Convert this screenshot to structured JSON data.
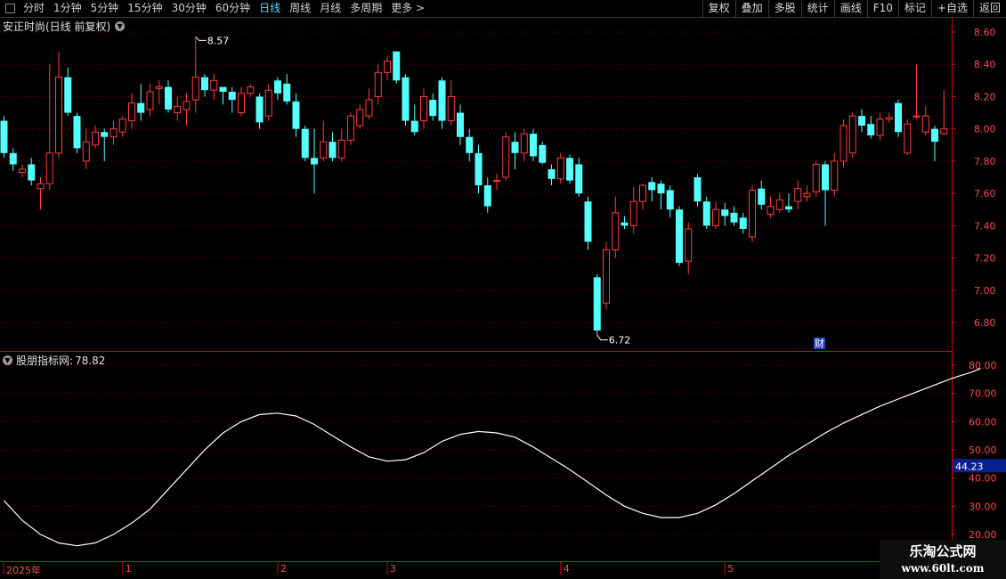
{
  "toolbar": {
    "left": [
      "分时",
      "1分钟",
      "5分钟",
      "15分钟",
      "30分钟",
      "60分钟",
      "日线",
      "周线",
      "月线",
      "多周期",
      "更多 >"
    ],
    "active": "日线",
    "right": [
      "复权",
      "叠加",
      "多股",
      "统计",
      "画线",
      "F10",
      "标记",
      "+自选",
      "返回"
    ]
  },
  "stock": {
    "title": "安正时尚(日线 前复权)"
  },
  "indicator": {
    "name": "股朋指标网",
    "sep": " : ",
    "value": "78.82",
    "cursor_value": "44.23"
  },
  "price_axis": {
    "ticks": [
      "8.60",
      "8.40",
      "8.20",
      "8.00",
      "7.80",
      "7.60",
      "7.40",
      "7.20",
      "7.00",
      "6.80"
    ],
    "min": 6.62,
    "max": 8.66
  },
  "ind_axis": {
    "ticks": [
      "80.00",
      "70.00",
      "60.00",
      "50.00",
      "40.00",
      "30.00",
      "20.00"
    ],
    "min": 15,
    "max": 85
  },
  "annotations": {
    "high": "8.57",
    "low": "6.72",
    "cai": "财"
  },
  "dates": [
    {
      "label": "2025年",
      "index": 0
    },
    {
      "label": "1",
      "index": 13
    },
    {
      "label": "2",
      "index": 30
    },
    {
      "label": "3",
      "index": 42
    },
    {
      "label": "4",
      "index": 61
    },
    {
      "label": "5",
      "index": 79
    }
  ],
  "watermark": {
    "line1": "乐淘公式网",
    "line2": "www.60lt.com"
  },
  "colors": {
    "up": "#ff3c3c",
    "down": "#54ffff",
    "grid": "#7a0000",
    "axis": "#d00000",
    "line": "#ffffff"
  },
  "chart_data": [
    {
      "type": "candlestick",
      "title": "安正时尚(日线 前复权)",
      "ylim": [
        6.62,
        8.66
      ],
      "candles": [
        [
          8.05,
          7.85,
          8.08,
          7.82
        ],
        [
          7.85,
          7.78,
          7.88,
          7.74
        ],
        [
          7.73,
          7.75,
          7.78,
          7.7
        ],
        [
          7.78,
          7.68,
          7.82,
          7.65
        ],
        [
          7.63,
          7.66,
          7.7,
          7.5
        ],
        [
          7.66,
          7.85,
          8.4,
          7.62
        ],
        [
          7.85,
          8.32,
          8.48,
          7.82
        ],
        [
          8.32,
          8.1,
          8.38,
          8.08
        ],
        [
          8.08,
          7.88,
          8.1,
          7.85
        ],
        [
          7.8,
          7.92,
          8.0,
          7.75
        ],
        [
          7.9,
          7.98,
          8.02,
          7.88
        ],
        [
          7.98,
          7.95,
          8.0,
          7.8
        ],
        [
          7.95,
          8.0,
          8.05,
          7.9
        ],
        [
          7.98,
          8.06,
          8.08,
          7.95
        ],
        [
          8.05,
          8.16,
          8.22,
          8.0
        ],
        [
          8.16,
          8.1,
          8.28,
          8.05
        ],
        [
          8.12,
          8.23,
          8.28,
          8.08
        ],
        [
          8.25,
          8.26,
          8.3,
          8.15
        ],
        [
          8.26,
          8.12,
          8.3,
          8.1
        ],
        [
          8.1,
          8.14,
          8.2,
          8.05
        ],
        [
          8.12,
          8.17,
          8.22,
          8.02
        ],
        [
          8.18,
          8.32,
          8.57,
          8.1
        ],
        [
          8.32,
          8.24,
          8.34,
          8.2
        ],
        [
          8.24,
          8.3,
          8.34,
          8.18
        ],
        [
          8.26,
          8.23,
          8.26,
          8.15
        ],
        [
          8.23,
          8.18,
          8.26,
          8.1
        ],
        [
          8.1,
          8.22,
          8.26,
          8.08
        ],
        [
          8.22,
          8.26,
          8.28,
          8.2
        ],
        [
          8.2,
          8.04,
          8.22,
          8.0
        ],
        [
          8.08,
          8.24,
          8.28,
          8.05
        ],
        [
          8.3,
          8.22,
          8.32,
          8.18
        ],
        [
          8.28,
          8.17,
          8.34,
          8.15
        ],
        [
          8.17,
          8.0,
          8.22,
          7.95
        ],
        [
          8.0,
          7.82,
          8.02,
          7.8
        ],
        [
          7.82,
          7.78,
          8.0,
          7.6
        ],
        [
          7.82,
          7.92,
          8.05,
          7.8
        ],
        [
          7.92,
          7.82,
          7.98,
          7.8
        ],
        [
          7.82,
          7.93,
          8.0,
          7.8
        ],
        [
          7.93,
          8.08,
          8.1,
          7.9
        ],
        [
          8.02,
          8.12,
          8.15,
          8.0
        ],
        [
          8.08,
          8.18,
          8.25,
          8.06
        ],
        [
          8.2,
          8.35,
          8.4,
          8.15
        ],
        [
          8.35,
          8.42,
          8.45,
          8.3
        ],
        [
          8.48,
          8.3,
          8.48,
          8.28
        ],
        [
          8.32,
          8.05,
          8.34,
          8.02
        ],
        [
          8.05,
          7.98,
          8.15,
          7.96
        ],
        [
          8.05,
          8.2,
          8.25,
          8.0
        ],
        [
          8.18,
          8.08,
          8.22,
          8.05
        ],
        [
          8.3,
          8.05,
          8.32,
          8.0
        ],
        [
          8.05,
          8.2,
          8.3,
          8.02
        ],
        [
          8.1,
          7.95,
          8.15,
          7.9
        ],
        [
          7.95,
          7.85,
          8.0,
          7.8
        ],
        [
          7.85,
          7.65,
          7.9,
          7.6
        ],
        [
          7.65,
          7.52,
          7.7,
          7.48
        ],
        [
          7.68,
          7.68,
          7.72,
          7.62
        ],
        [
          7.7,
          7.95,
          7.98,
          7.68
        ],
        [
          7.92,
          7.85,
          7.98,
          7.75
        ],
        [
          7.85,
          7.97,
          8.0,
          7.8
        ],
        [
          7.97,
          7.83,
          8.0,
          7.8
        ],
        [
          7.9,
          7.79,
          7.92,
          7.78
        ],
        [
          7.75,
          7.69,
          7.78,
          7.65
        ],
        [
          7.69,
          7.82,
          7.85,
          7.66
        ],
        [
          7.82,
          7.68,
          7.84,
          7.66
        ],
        [
          7.78,
          7.6,
          7.82,
          7.58
        ],
        [
          7.55,
          7.3,
          7.58,
          7.25
        ],
        [
          7.08,
          6.75,
          7.1,
          6.72
        ],
        [
          6.92,
          7.25,
          7.3,
          6.88
        ],
        [
          7.25,
          7.48,
          7.58,
          7.2
        ],
        [
          7.42,
          7.4,
          7.46,
          7.38
        ],
        [
          7.4,
          7.55,
          7.64,
          7.35
        ],
        [
          7.55,
          7.65,
          7.66,
          7.5
        ],
        [
          7.67,
          7.62,
          7.7,
          7.55
        ],
        [
          7.66,
          7.6,
          7.68,
          7.5
        ],
        [
          7.62,
          7.5,
          7.65,
          7.45
        ],
        [
          7.5,
          7.17,
          7.52,
          7.15
        ],
        [
          7.18,
          7.38,
          7.42,
          7.1
        ],
        [
          7.7,
          7.55,
          7.72,
          7.52
        ],
        [
          7.55,
          7.4,
          7.58,
          7.38
        ],
        [
          7.4,
          7.5,
          7.55,
          7.38
        ],
        [
          7.5,
          7.46,
          7.54,
          7.4
        ],
        [
          7.48,
          7.42,
          7.52,
          7.4
        ],
        [
          7.45,
          7.38,
          7.48,
          7.35
        ],
        [
          7.33,
          7.62,
          7.65,
          7.3
        ],
        [
          7.63,
          7.53,
          7.68,
          7.5
        ],
        [
          7.47,
          7.52,
          7.58,
          7.45
        ],
        [
          7.5,
          7.56,
          7.6,
          7.48
        ],
        [
          7.52,
          7.5,
          7.6,
          7.48
        ],
        [
          7.55,
          7.63,
          7.68,
          7.5
        ],
        [
          7.58,
          7.6,
          7.65,
          7.55
        ],
        [
          7.61,
          7.78,
          7.8,
          7.58
        ],
        [
          7.78,
          7.62,
          7.8,
          7.4
        ],
        [
          7.62,
          7.8,
          7.85,
          7.58
        ],
        [
          7.8,
          8.02,
          8.06,
          7.76
        ],
        [
          7.85,
          8.08,
          8.1,
          7.82
        ],
        [
          8.08,
          8.02,
          8.12,
          7.98
        ],
        [
          8.03,
          7.96,
          8.08,
          7.94
        ],
        [
          7.96,
          8.06,
          8.1,
          7.93
        ],
        [
          8.06,
          8.07,
          8.1,
          8.04
        ],
        [
          8.16,
          7.98,
          8.18,
          7.95
        ],
        [
          7.85,
          8.03,
          8.06,
          7.84
        ],
        [
          8.08,
          8.08,
          8.4,
          8.06
        ],
        [
          7.98,
          8.08,
          8.14,
          7.96
        ],
        [
          8.0,
          7.92,
          8.02,
          7.8
        ],
        [
          7.97,
          8.0,
          8.24,
          7.96
        ]
      ]
    },
    {
      "type": "line",
      "title": "股朋指标网",
      "ylim": [
        15,
        85
      ],
      "points": [
        [
          0,
          32
        ],
        [
          2,
          25
        ],
        [
          4,
          20
        ],
        [
          6,
          17
        ],
        [
          8,
          16
        ],
        [
          10,
          17
        ],
        [
          12,
          20
        ],
        [
          14,
          24
        ],
        [
          16,
          29
        ],
        [
          18,
          36
        ],
        [
          20,
          43
        ],
        [
          22,
          50
        ],
        [
          24,
          56
        ],
        [
          26,
          60
        ],
        [
          28,
          62.5
        ],
        [
          30,
          63
        ],
        [
          32,
          62
        ],
        [
          34,
          59
        ],
        [
          36,
          55
        ],
        [
          38,
          51
        ],
        [
          40,
          47.5
        ],
        [
          42,
          46
        ],
        [
          44,
          46.5
        ],
        [
          46,
          49
        ],
        [
          48,
          53
        ],
        [
          50,
          55.5
        ],
        [
          52,
          56.5
        ],
        [
          54,
          56
        ],
        [
          56,
          54.5
        ],
        [
          58,
          51
        ],
        [
          60,
          47
        ],
        [
          62,
          43
        ],
        [
          64,
          38.5
        ],
        [
          66,
          34
        ],
        [
          68,
          30
        ],
        [
          70,
          27.5
        ],
        [
          72,
          26
        ],
        [
          74,
          26
        ],
        [
          76,
          27.5
        ],
        [
          78,
          30.5
        ],
        [
          80,
          34.5
        ],
        [
          82,
          39
        ],
        [
          84,
          43.5
        ],
        [
          86,
          48
        ],
        [
          88,
          52
        ],
        [
          90,
          56
        ],
        [
          92,
          59.5
        ],
        [
          94,
          62.5
        ],
        [
          96,
          65.5
        ],
        [
          98,
          68
        ],
        [
          100,
          70.5
        ],
        [
          102,
          73
        ],
        [
          104,
          75.5
        ],
        [
          106,
          77.5
        ],
        [
          107,
          78.82
        ]
      ]
    }
  ]
}
